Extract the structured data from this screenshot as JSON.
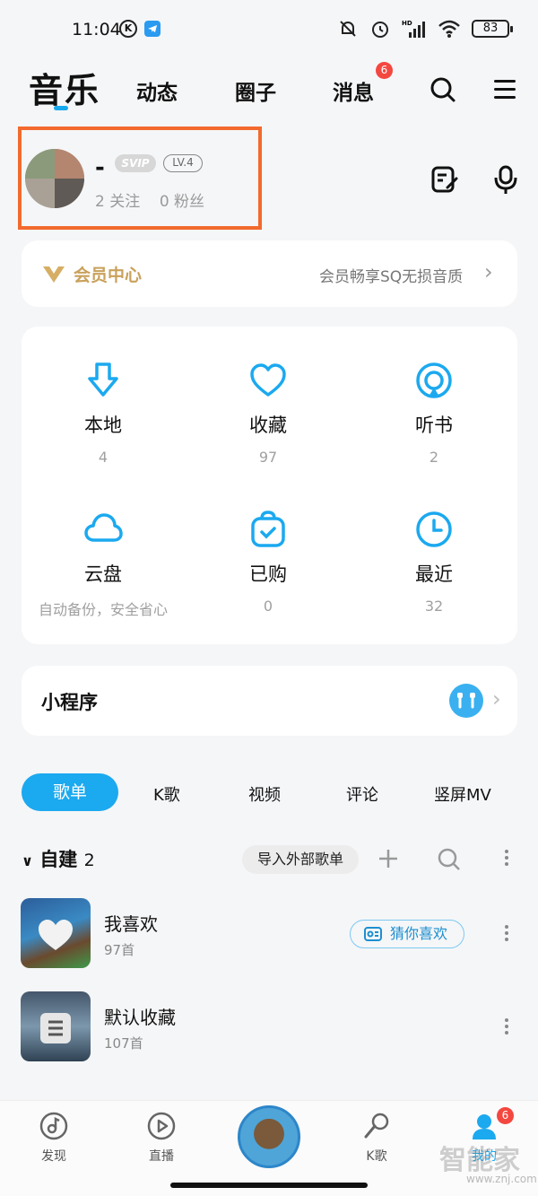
{
  "status_bar": {
    "time": "11:04",
    "k_badge": "K",
    "battery": "83",
    "hd": "HD"
  },
  "top_nav": {
    "active": "音乐",
    "tabs": [
      "动态",
      "圈子",
      "消息"
    ],
    "message_badge": "6"
  },
  "profile": {
    "nickname": "-",
    "svip": "SVIP",
    "level": "LV.4",
    "stats": "2 关注    0 粉丝"
  },
  "vip": {
    "title": "会员中心",
    "subtitle": "会员畅享SQ无损音质",
    "chevron": "›"
  },
  "grid": [
    {
      "label": "本地",
      "count": "4"
    },
    {
      "label": "收藏",
      "count": "97"
    },
    {
      "label": "听书",
      "count": "2"
    },
    {
      "label": "云盘",
      "count": "自动备份，安全省心"
    },
    {
      "label": "已购",
      "count": "0"
    },
    {
      "label": "最近",
      "count": "32"
    }
  ],
  "mini_program": {
    "title": "小程序",
    "chevron": "›"
  },
  "content_tabs": [
    "歌单",
    "K歌",
    "视频",
    "评论",
    "竖屏MV"
  ],
  "playlists_header": {
    "chevron": "∨",
    "title": "自建",
    "count": "2",
    "import": "导入外部歌单"
  },
  "playlists": [
    {
      "name": "我喜欢",
      "count": "97首",
      "action": "猜你喜欢"
    },
    {
      "name": "默认收藏",
      "count": "107首"
    }
  ],
  "bottom_nav": [
    {
      "label": "发现"
    },
    {
      "label": "直播"
    },
    {
      "label": "K歌"
    },
    {
      "label": "我的",
      "badge": "6"
    }
  ],
  "watermark": {
    "text": "智能家",
    "url": "www.znj.com"
  },
  "colors": {
    "accent": "#1ba9ef",
    "vip_gold": "#c9a15b",
    "highlight_box": "#f26a2e",
    "badge_red": "#f4473f"
  }
}
